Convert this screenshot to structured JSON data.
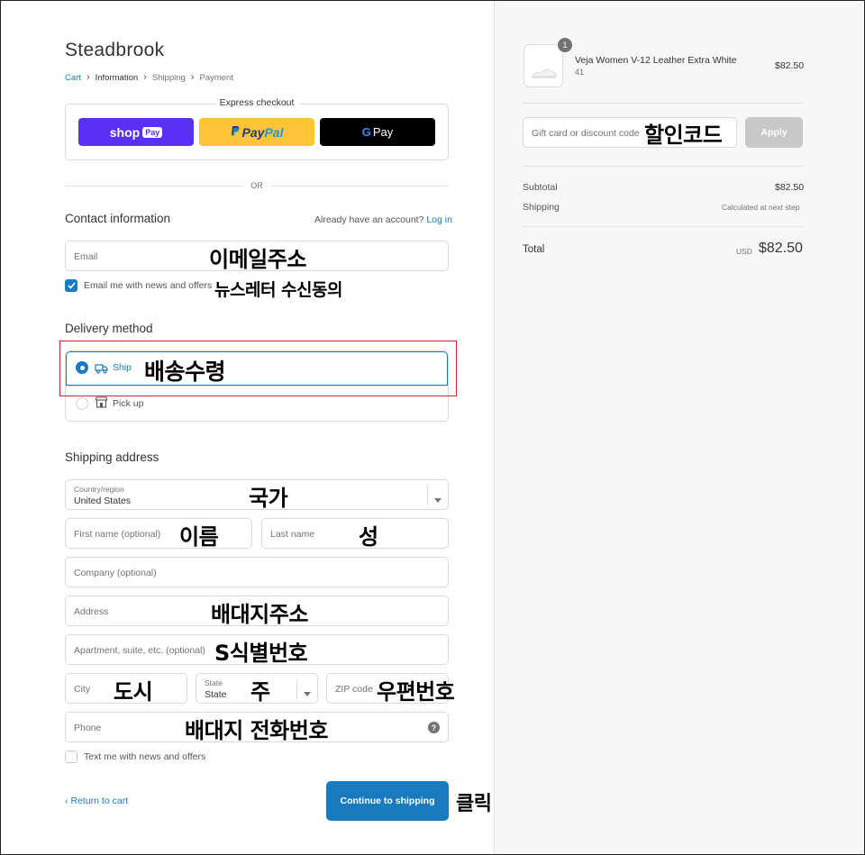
{
  "store_name": "Steadbrook",
  "breadcrumb": {
    "cart": "Cart",
    "information": "Information",
    "shipping": "Shipping",
    "payment": "Payment"
  },
  "express": {
    "title": "Express checkout",
    "shop": "shop",
    "shop_badge": "Pay",
    "paypal_a": "Pay",
    "paypal_b": "Pal",
    "gpay_g": "G",
    "gpay_pay": "Pay"
  },
  "or_label": "OR",
  "contact": {
    "heading": "Contact information",
    "account_q": "Already have an account?",
    "login": "Log in",
    "email_placeholder": "Email",
    "email_offers": "Email me with news and offers"
  },
  "delivery": {
    "heading": "Delivery method",
    "ship": "Ship",
    "pickup": "Pick up"
  },
  "shipping_address": {
    "heading": "Shipping address",
    "country_label": "Country/region",
    "country_value": "United States",
    "first_name": "First name (optional)",
    "last_name": "Last name",
    "company": "Company (optional)",
    "address": "Address",
    "apartment": "Apartment, suite, etc. (optional)",
    "city": "City",
    "state_label": "State",
    "state_value": "State",
    "zip": "ZIP code",
    "phone": "Phone",
    "text_offers": "Text me with news and offers"
  },
  "actions": {
    "return": "Return to cart",
    "continue": "Continue to shipping"
  },
  "annotations": {
    "email": "이메일주소",
    "newsletter": "뉴스레터 수신동의",
    "ship": "배송수령",
    "country": "국가",
    "first_name": "이름",
    "last_name": "성",
    "address": "배대지주소",
    "apartment": "S식별번호",
    "city": "도시",
    "state": "주",
    "zip": "우편번호",
    "phone": "배대지 전화번호",
    "continue": "클릭",
    "discount": "할인코드"
  },
  "summary": {
    "quantity": "1",
    "product_name": "Veja Women V-12 Leather Extra White",
    "variant": "41",
    "product_price": "$82.50",
    "discount_placeholder": "Gift card or discount code",
    "apply": "Apply",
    "subtotal_label": "Subtotal",
    "subtotal_value": "$82.50",
    "shipping_label": "Shipping",
    "shipping_value": "Calculated at next step",
    "total_label": "Total",
    "currency": "USD",
    "total_value": "$82.50"
  },
  "colors": {
    "accent": "#197bbd",
    "annotation_box": "#d1252b"
  }
}
